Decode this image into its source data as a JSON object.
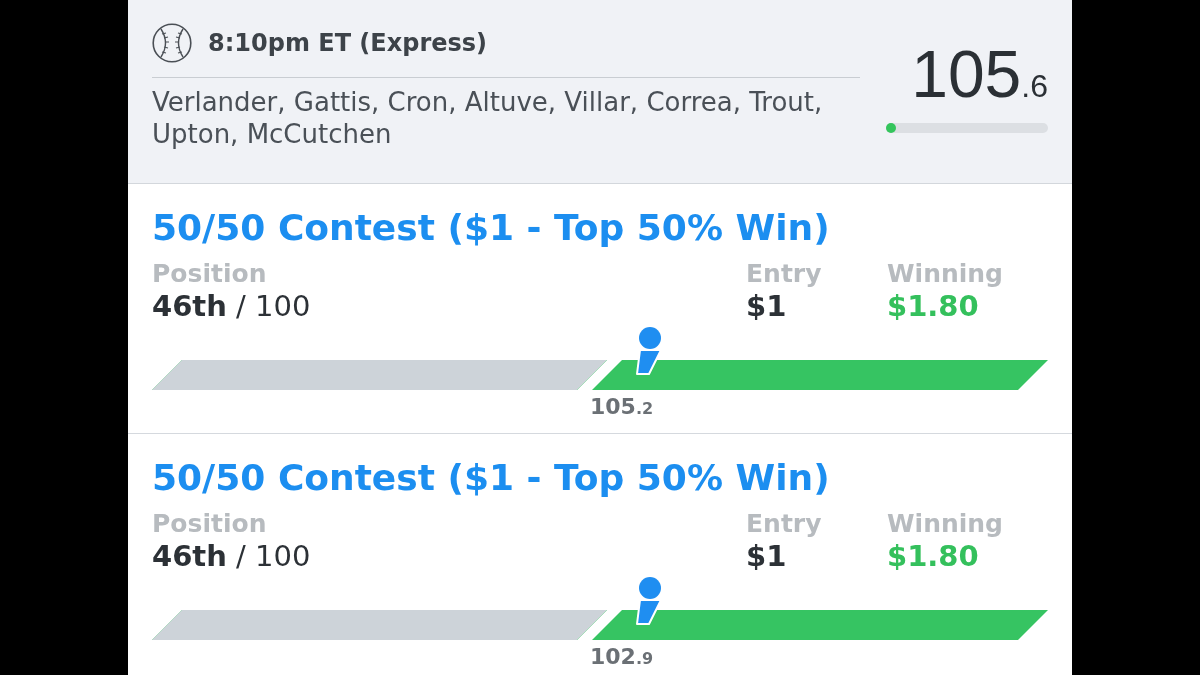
{
  "header": {
    "title": "8:10pm ET (Express)",
    "players": "Verlander, Gattis, Cron, Altuve, Villar, Correa, Trout, Upton, McCutchen",
    "score": "105.6",
    "progress": {
      "level": 0.06
    }
  },
  "contests": [
    {
      "title": "50/50 Contest ($1 - Top 50% Win)",
      "position_label": "Position",
      "position": "**46th** / 100",
      "entry_label": "Entry",
      "entry": "$1",
      "winning_label": "Winning",
      "winning": "$1.80",
      "cutoff": {
        "level": 0.5,
        "score": "105.2"
      },
      "marker": {
        "level": 0.55
      }
    },
    {
      "title": "50/50 Contest ($1 - Top 50% Win)",
      "position_label": "Position",
      "position": "**46th** / 100",
      "entry_label": "Entry",
      "entry": "$1",
      "winning_label": "Winning",
      "winning": "$1.80",
      "cutoff": {
        "level": 0.5,
        "score": "102.9"
      },
      "marker": {
        "level": 0.55
      }
    }
  ]
}
